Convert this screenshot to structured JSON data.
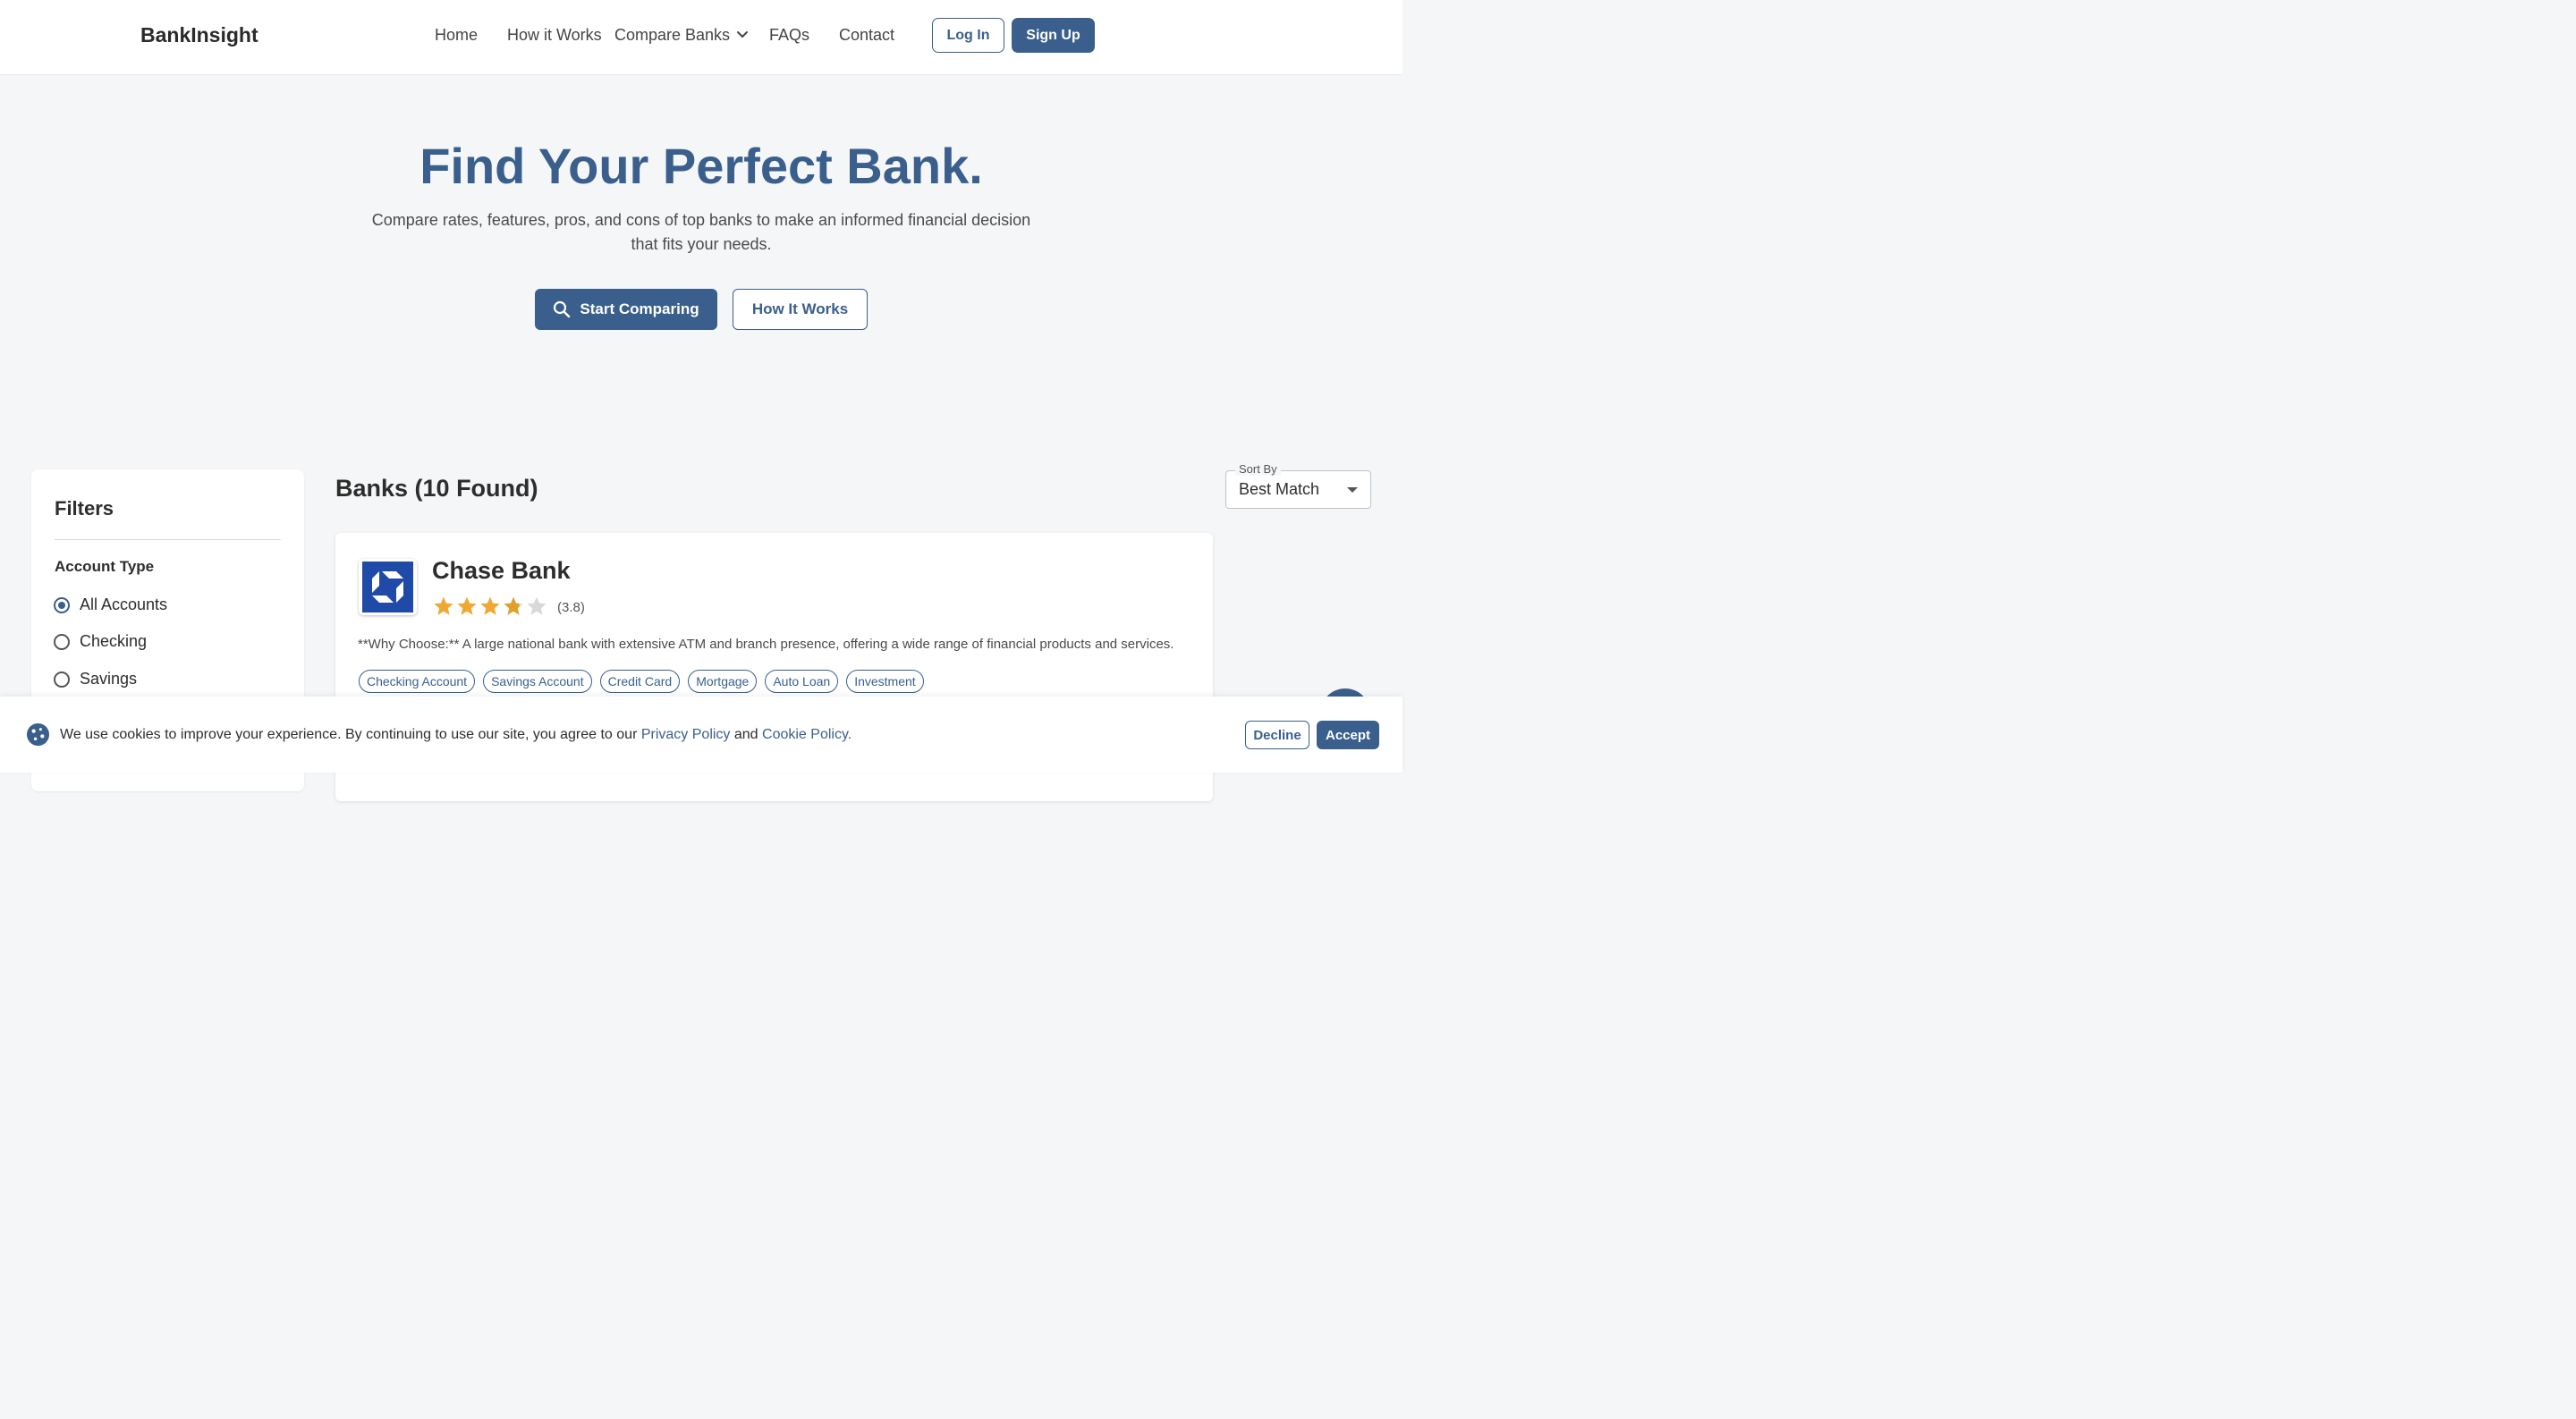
{
  "colors": {
    "accent": "#3a5f8c",
    "star": "#f0a832",
    "star_empty": "#d9d9d9",
    "background": "#f4f6f8",
    "chase_blue": "#1f4aa8"
  },
  "header": {
    "brand": "BankInsight",
    "nav": [
      "Home",
      "How it Works",
      "Compare Banks",
      "FAQs",
      "Contact"
    ],
    "login_label": "Log In",
    "signup_label": "Sign Up"
  },
  "hero": {
    "title": "Find Your Perfect Bank.",
    "subtitle": "Compare rates, features, pros, and cons of top banks to make an informed financial decision that fits your needs.",
    "primary_button": "Start Comparing",
    "primary_icon": "search-icon",
    "secondary_button": "How It Works"
  },
  "filters": {
    "title": "Filters",
    "account_type_label": "Account Type",
    "options": [
      "All Accounts",
      "Checking",
      "Savings"
    ],
    "selected": "All Accounts"
  },
  "results": {
    "title": "Banks (10 Found)",
    "sort_label": "Sort By",
    "sort_value": "Best Match"
  },
  "bank_card": {
    "name": "Chase Bank",
    "logo_icon": "chase-octagon-logo",
    "rating": 3.8,
    "rating_max": 5,
    "rating_text": "(3.8)",
    "why": "**Why Choose:** A large national bank with extensive ATM and branch presence, offering a wide range of financial products and services.",
    "tags": [
      "Checking Account",
      "Savings Account",
      "Credit Card",
      "Mortgage",
      "Auto Loan",
      "Investment"
    ]
  },
  "cookie": {
    "icon": "cookie-icon",
    "text_before": "We use cookies to improve your experience. By continuing to use our site, you agree to our ",
    "privacy_link": "Privacy Policy",
    "text_between": " and ",
    "cookie_link": "Cookie Policy",
    "text_after": ".",
    "decline_label": "Decline",
    "accept_label": "Accept"
  }
}
